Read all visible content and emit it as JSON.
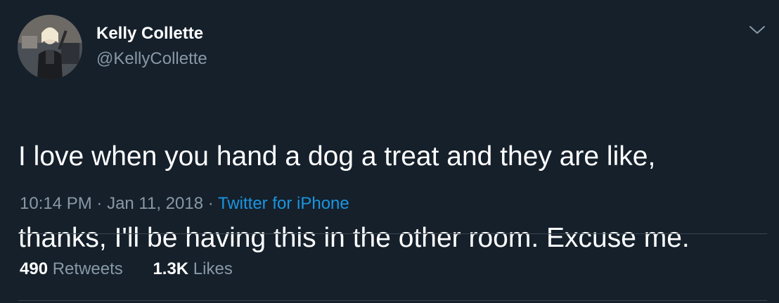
{
  "author": {
    "name": "Kelly Collette",
    "handle": "@KellyCollette",
    "avatar_icon": "profile-photo"
  },
  "tweet": {
    "text_line1": "I love when you hand a dog a treat and they are like,",
    "text_line2": "thanks, I'll be having this in the other room. Excuse me."
  },
  "meta": {
    "time": "10:14 PM",
    "sep1": " · ",
    "date": "Jan 11, 2018",
    "sep2": " · ",
    "source": "Twitter for iPhone"
  },
  "stats": {
    "retweets_count": "490",
    "retweets_label": " Retweets",
    "likes_count": "1.3K",
    "likes_label": " Likes"
  },
  "colors": {
    "background": "#15202b",
    "secondary_text": "#8899a6",
    "link": "#1b95e0",
    "divider": "#38444d"
  },
  "icons": {
    "menu": "chevron-down-icon"
  }
}
